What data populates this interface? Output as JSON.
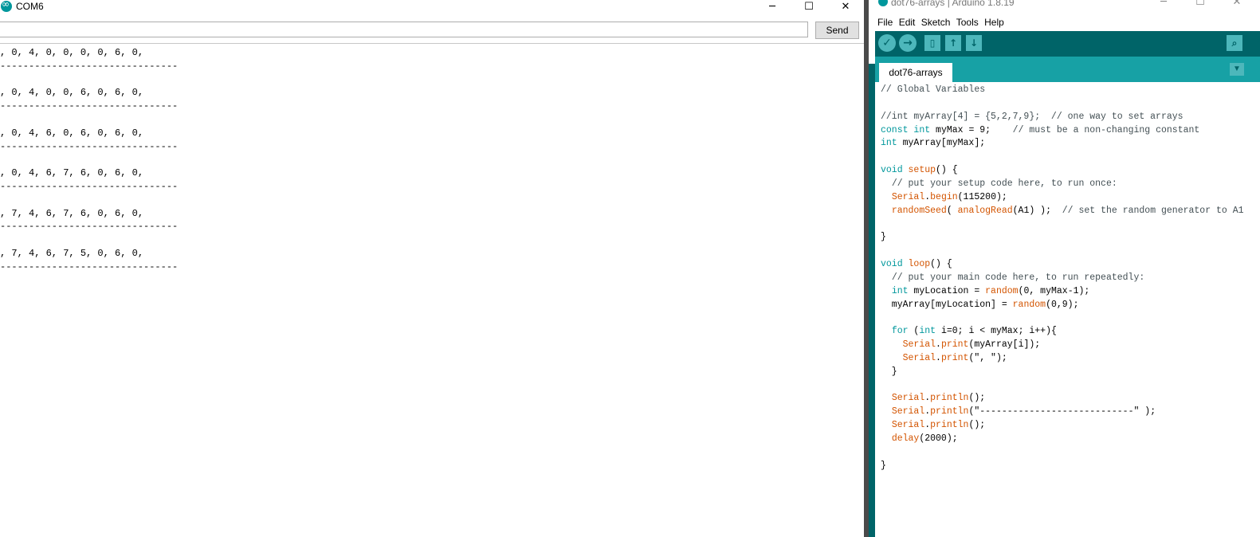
{
  "serial": {
    "title": "COM6",
    "send_label": "Send",
    "input_value": "",
    "output": [
      ", 0, 4, 0, 0, 0, 0, 6, 0,",
      "-------------------------------",
      "",
      ", 0, 4, 0, 0, 6, 0, 6, 0,",
      "-------------------------------",
      "",
      ", 0, 4, 6, 0, 6, 0, 6, 0,",
      "-------------------------------",
      "",
      ", 0, 4, 6, 7, 6, 0, 6, 0,",
      "-------------------------------",
      "",
      ", 7, 4, 6, 7, 6, 0, 6, 0,",
      "-------------------------------",
      "",
      ", 7, 4, 6, 7, 5, 0, 6, 0,",
      "-------------------------------"
    ]
  },
  "ide": {
    "title": "dot76-arrays | Arduino 1.8.19",
    "menu": [
      "File",
      "Edit",
      "Sketch",
      "Tools",
      "Help"
    ],
    "toolbar": {
      "verify": "verify-icon",
      "upload": "upload-icon",
      "new": "new-file-icon",
      "open": "open-icon",
      "save": "save-icon",
      "serial_monitor": "serial-monitor-icon"
    },
    "tab_label": "dot76-arrays",
    "code": [
      [
        [
          "cm",
          "// Global Variables"
        ]
      ],
      [],
      [
        [
          "cm",
          "//int myArray[4] = {5,2,7,9};  // one way to set arrays"
        ]
      ],
      [
        [
          "kw",
          "const"
        ],
        [
          "tx",
          " "
        ],
        [
          "kw",
          "int"
        ],
        [
          "tx",
          " myMax = 9;    "
        ],
        [
          "cm",
          "// must be a non-changing constant"
        ]
      ],
      [
        [
          "kw",
          "int"
        ],
        [
          "tx",
          " myArray[myMax];"
        ]
      ],
      [],
      [
        [
          "kw",
          "void"
        ],
        [
          "tx",
          " "
        ],
        [
          "fn",
          "setup"
        ],
        [
          "tx",
          "() {"
        ]
      ],
      [
        [
          "tx",
          "  "
        ],
        [
          "cm",
          "// put your setup code here, to run once:"
        ]
      ],
      [
        [
          "tx",
          "  "
        ],
        [
          "fn",
          "Serial"
        ],
        [
          "tx",
          "."
        ],
        [
          "fn",
          "begin"
        ],
        [
          "tx",
          "(115200);"
        ]
      ],
      [
        [
          "tx",
          "  "
        ],
        [
          "fn",
          "randomSeed"
        ],
        [
          "tx",
          "( "
        ],
        [
          "fn",
          "analogRead"
        ],
        [
          "tx",
          "(A1) );  "
        ],
        [
          "cm",
          "// set the random generator to A1"
        ]
      ],
      [],
      [
        [
          "tx",
          "}"
        ]
      ],
      [],
      [
        [
          "kw",
          "void"
        ],
        [
          "tx",
          " "
        ],
        [
          "fn",
          "loop"
        ],
        [
          "tx",
          "() {"
        ]
      ],
      [
        [
          "tx",
          "  "
        ],
        [
          "cm",
          "// put your main code here, to run repeatedly:"
        ]
      ],
      [
        [
          "tx",
          "  "
        ],
        [
          "kw",
          "int"
        ],
        [
          "tx",
          " myLocation = "
        ],
        [
          "fn",
          "random"
        ],
        [
          "tx",
          "(0, myMax-1);"
        ]
      ],
      [
        [
          "tx",
          "  myArray[myLocation] = "
        ],
        [
          "fn",
          "random"
        ],
        [
          "tx",
          "(0,9);"
        ]
      ],
      [],
      [
        [
          "tx",
          "  "
        ],
        [
          "kw",
          "for"
        ],
        [
          "tx",
          " ("
        ],
        [
          "kw",
          "int"
        ],
        [
          "tx",
          " i=0; i < myMax; i++){"
        ]
      ],
      [
        [
          "tx",
          "    "
        ],
        [
          "fn",
          "Serial"
        ],
        [
          "tx",
          "."
        ],
        [
          "fn",
          "print"
        ],
        [
          "tx",
          "(myArray[i]);"
        ]
      ],
      [
        [
          "tx",
          "    "
        ],
        [
          "fn",
          "Serial"
        ],
        [
          "tx",
          "."
        ],
        [
          "fn",
          "print"
        ],
        [
          "tx",
          "(\", \");"
        ]
      ],
      [
        [
          "tx",
          "  }"
        ]
      ],
      [],
      [
        [
          "tx",
          "  "
        ],
        [
          "fn",
          "Serial"
        ],
        [
          "tx",
          "."
        ],
        [
          "fn",
          "println"
        ],
        [
          "tx",
          "();"
        ]
      ],
      [
        [
          "tx",
          "  "
        ],
        [
          "fn",
          "Serial"
        ],
        [
          "tx",
          "."
        ],
        [
          "fn",
          "println"
        ],
        [
          "tx",
          "(\"----------------------------\" );"
        ]
      ],
      [
        [
          "tx",
          "  "
        ],
        [
          "fn",
          "Serial"
        ],
        [
          "tx",
          "."
        ],
        [
          "fn",
          "println"
        ],
        [
          "tx",
          "();"
        ]
      ],
      [
        [
          "tx",
          "  "
        ],
        [
          "fn",
          "delay"
        ],
        [
          "tx",
          "(2000);"
        ]
      ],
      [],
      [
        [
          "tx",
          "}"
        ]
      ]
    ]
  }
}
